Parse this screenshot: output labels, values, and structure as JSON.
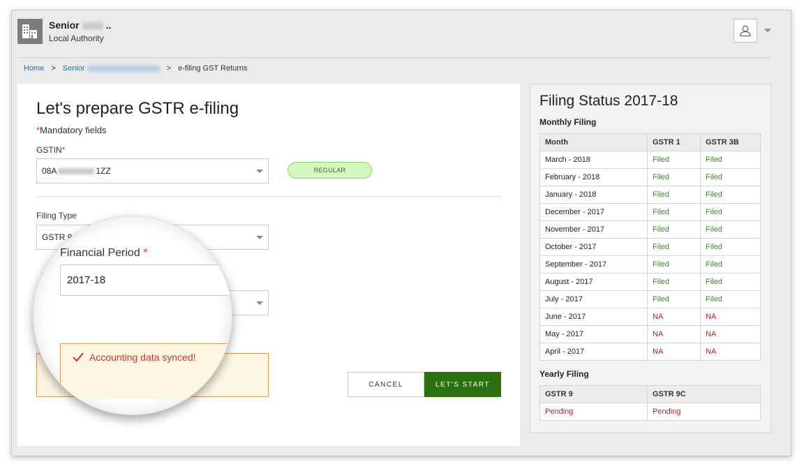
{
  "header": {
    "org_name_prefix": "Senior",
    "org_name_suffix": "..",
    "org_subtitle": "Local Authority",
    "org_icon": "building-icon",
    "user_icon": "user-icon"
  },
  "breadcrumb": {
    "home": "Home",
    "office_prefix": "Senior",
    "separator": ">",
    "current": "e-filing GST Returns"
  },
  "form": {
    "title": "Let's prepare GSTR e-filing",
    "mandatory_star": "*",
    "mandatory_text": "Mandatory fields",
    "gstin_label": "GSTIN",
    "gstin_prefix": "08A",
    "gstin_suffix": "1ZZ",
    "taxpayer_type": "REGULAR",
    "filing_type_label": "Filing Type",
    "filing_type_value": "GSTR 9",
    "financial_period_label": "Financial Period",
    "financial_period_value": "2017-18",
    "alert_text": "Accounting data synced!",
    "cancel_label": "CANCEL",
    "start_label": "LET'S START"
  },
  "status": {
    "title": "Filing Status 2017-18",
    "monthly_title": "Monthly Filing",
    "monthly_headers": [
      "Month",
      "GSTR 1",
      "GSTR 3B"
    ],
    "monthly_rows": [
      [
        "March - 2018",
        "Filed",
        "Filed"
      ],
      [
        "February - 2018",
        "Filed",
        "Filed"
      ],
      [
        "January - 2018",
        "Filed",
        "Filed"
      ],
      [
        "December - 2017",
        "Filed",
        "Filed"
      ],
      [
        "November - 2017",
        "Filed",
        "Filed"
      ],
      [
        "October - 2017",
        "Filed",
        "Filed"
      ],
      [
        "September - 2017",
        "Filed",
        "Filed"
      ],
      [
        "August - 2017",
        "Filed",
        "Filed"
      ],
      [
        "July - 2017",
        "Filed",
        "Filed"
      ],
      [
        "June - 2017",
        "NA",
        "NA"
      ],
      [
        "May - 2017",
        "NA",
        "NA"
      ],
      [
        "April - 2017",
        "NA",
        "NA"
      ]
    ],
    "yearly_title": "Yearly Filing",
    "yearly_headers": [
      "GSTR 9",
      "GSTR 9C"
    ],
    "yearly_row": [
      "Pending",
      "Pending"
    ]
  },
  "colors": {
    "primary_button": "#2e6f12",
    "filed": "#3b8a2a",
    "na": "#b22222",
    "link": "#1f6fb2"
  }
}
